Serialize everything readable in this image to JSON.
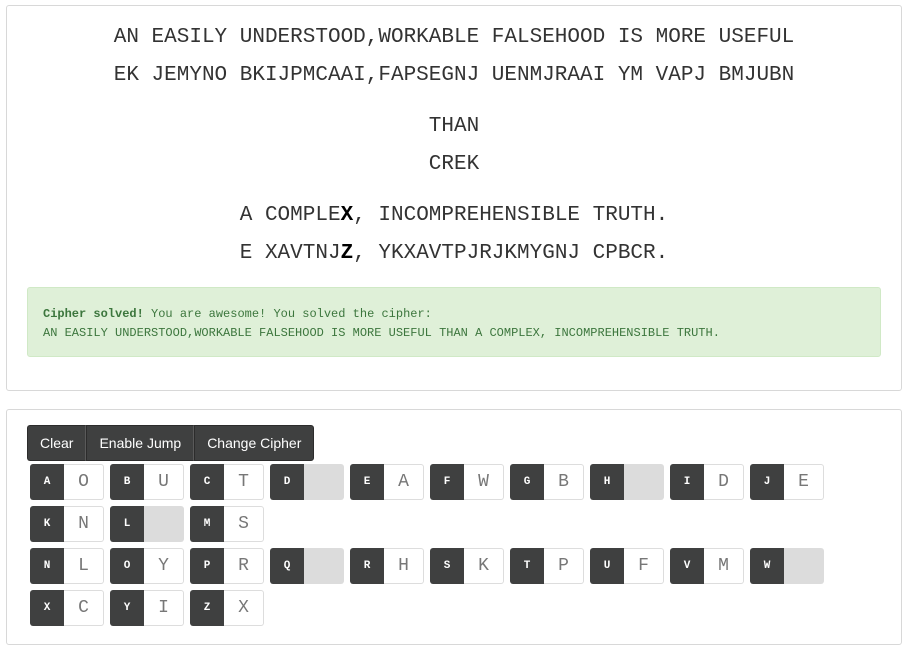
{
  "puzzle": {
    "lines": [
      {
        "plain": "AN EASILY UNDERSTOOD,WORKABLE FALSEHOOD IS MORE USEFUL",
        "cipher": "EK JEMYNO BKIJPMCAAI,FAPSEGNJ UENMJRAAI YM VAPJ BMJUBN"
      },
      {
        "plain": "THAN",
        "cipher": "CREK"
      },
      {
        "plain_before": "A COMPLE",
        "plain_mark": "X",
        "plain_after": ", INCOMPREHENSIBLE TRUTH.",
        "cipher_before": "E XAVTNJ",
        "cipher_mark": "Z",
        "cipher_after": ", YKXAVTPJRJKMYGNJ CPBCR."
      }
    ]
  },
  "alert": {
    "title": "Cipher solved!",
    "message": " You are awesome! You solved the cipher:",
    "solution": "AN EASILY UNDERSTOOD,WORKABLE FALSEHOOD IS MORE USEFUL THAN A COMPLEX, INCOMPREHENSIBLE TRUTH."
  },
  "toolbar": {
    "clear": "Clear",
    "enable_jump": "Enable Jump",
    "change_cipher": "Change Cipher"
  },
  "keys": [
    {
      "k": "A",
      "v": "O"
    },
    {
      "k": "B",
      "v": "U"
    },
    {
      "k": "C",
      "v": "T"
    },
    {
      "k": "D",
      "v": ""
    },
    {
      "k": "E",
      "v": "A"
    },
    {
      "k": "F",
      "v": "W"
    },
    {
      "k": "G",
      "v": "B"
    },
    {
      "k": "H",
      "v": ""
    },
    {
      "k": "I",
      "v": "D"
    },
    {
      "k": "J",
      "v": "E"
    },
    {
      "k": "K",
      "v": "N"
    },
    {
      "k": "L",
      "v": ""
    },
    {
      "k": "M",
      "v": "S"
    },
    {
      "k": "N",
      "v": "L"
    },
    {
      "k": "O",
      "v": "Y"
    },
    {
      "k": "P",
      "v": "R"
    },
    {
      "k": "Q",
      "v": ""
    },
    {
      "k": "R",
      "v": "H"
    },
    {
      "k": "S",
      "v": "K"
    },
    {
      "k": "T",
      "v": "P"
    },
    {
      "k": "U",
      "v": "F"
    },
    {
      "k": "V",
      "v": "M"
    },
    {
      "k": "W",
      "v": ""
    },
    {
      "k": "X",
      "v": "C"
    },
    {
      "k": "Y",
      "v": "I"
    },
    {
      "k": "Z",
      "v": "X"
    }
  ]
}
